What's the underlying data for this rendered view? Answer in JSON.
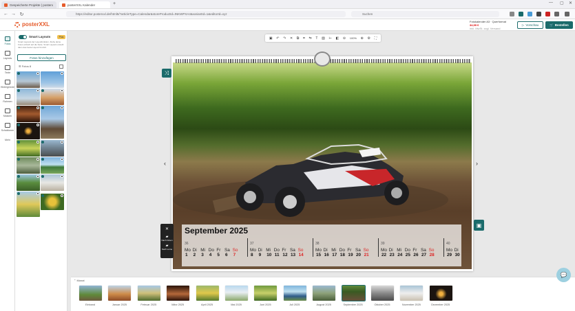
{
  "browser": {
    "tabs": [
      {
        "label": "Gespeicherte Projekte | posterx"
      },
      {
        "label": "posterXXL Kalender"
      }
    ],
    "url": "https://editor.posterxxl.de/html5/?articleType=Calendar&storeProductId=INKWPXA4&variantId=1&editorId=xyz",
    "search_placeholder": "Suchen"
  },
  "app": {
    "logo": "posterXXL",
    "product_name": "Fotokalender A3 · Querformat",
    "price": "34,99 €",
    "product_sub": "inkl. MwSt. zzgl. Versand",
    "preview_label": "Vorschau",
    "order_label": "Bestellen"
  },
  "rail": [
    {
      "label": "Fotos"
    },
    {
      "label": "Layouts"
    },
    {
      "label": "Texte"
    },
    {
      "label": "Hintergründe"
    },
    {
      "label": "Rahmen"
    },
    {
      "label": "Masken"
    },
    {
      "label": "Schablonen"
    },
    {
      "label": "Mehr"
    }
  ],
  "panel": {
    "smart_label": "Smart Layouts",
    "plus_badge": "Plus",
    "smart_desc": "Smart Layouts der Layoutfunktion. Ziehe deine Fotos einfach auf die Seite. Smart Layouts erstellt dann das beste Layout für dich.",
    "upload_label": "Fotos hinzufügen",
    "filter_label": "Fotos",
    "count": "8"
  },
  "toolbar": {
    "zoom": "100%"
  },
  "calendar": {
    "month_title": "September 2025",
    "weeks": [
      {
        "kw": "36",
        "days": [
          {
            "n": "Mo",
            "d": "1"
          },
          {
            "n": "Di",
            "d": "2"
          },
          {
            "n": "Mi",
            "d": "3"
          },
          {
            "n": "Do",
            "d": "4"
          },
          {
            "n": "Fr",
            "d": "5"
          },
          {
            "n": "Sa",
            "d": "6"
          },
          {
            "n": "So",
            "d": "7"
          }
        ]
      },
      {
        "kw": "37",
        "days": [
          {
            "n": "Mo",
            "d": "8"
          },
          {
            "n": "Di",
            "d": "9"
          },
          {
            "n": "Mi",
            "d": "10"
          },
          {
            "n": "Do",
            "d": "11"
          },
          {
            "n": "Fr",
            "d": "12"
          },
          {
            "n": "Sa",
            "d": "13"
          },
          {
            "n": "So",
            "d": "14"
          }
        ]
      },
      {
        "kw": "38",
        "days": [
          {
            "n": "Mo",
            "d": "15"
          },
          {
            "n": "Di",
            "d": "16"
          },
          {
            "n": "Mi",
            "d": "17"
          },
          {
            "n": "Do",
            "d": "18"
          },
          {
            "n": "Fr",
            "d": "19"
          },
          {
            "n": "Sa",
            "d": "20"
          },
          {
            "n": "So",
            "d": "21"
          }
        ]
      },
      {
        "kw": "39",
        "days": [
          {
            "n": "Mo",
            "d": "22"
          },
          {
            "n": "Di",
            "d": "23"
          },
          {
            "n": "Mi",
            "d": "24"
          },
          {
            "n": "Do",
            "d": "25"
          },
          {
            "n": "Fr",
            "d": "26"
          },
          {
            "n": "Sa",
            "d": "27"
          },
          {
            "n": "So",
            "d": "28"
          }
        ]
      },
      {
        "kw": "40",
        "days": [
          {
            "n": "Mo",
            "d": "29"
          },
          {
            "n": "Di",
            "d": "30"
          }
        ]
      }
    ]
  },
  "layer_popup": {
    "item1": "Nach hinten",
    "item2": "Nach vorne"
  },
  "strip": {
    "label": "Monat",
    "pages": [
      {
        "label": "Einband"
      },
      {
        "label": "Januar 2025"
      },
      {
        "label": "Februar 2025"
      },
      {
        "label": "März 2025"
      },
      {
        "label": "April 2025"
      },
      {
        "label": "Mai 2025"
      },
      {
        "label": "Juni 2025"
      },
      {
        "label": "Juli 2025"
      },
      {
        "label": "August 2025"
      },
      {
        "label": "September 2025"
      },
      {
        "label": "Oktober 2025"
      },
      {
        "label": "November 2025"
      },
      {
        "label": "Dezember 2025"
      }
    ]
  },
  "colors": {
    "accent": "#1b6b6b",
    "brand": "#e65b2b",
    "sunday": "#d22222"
  }
}
